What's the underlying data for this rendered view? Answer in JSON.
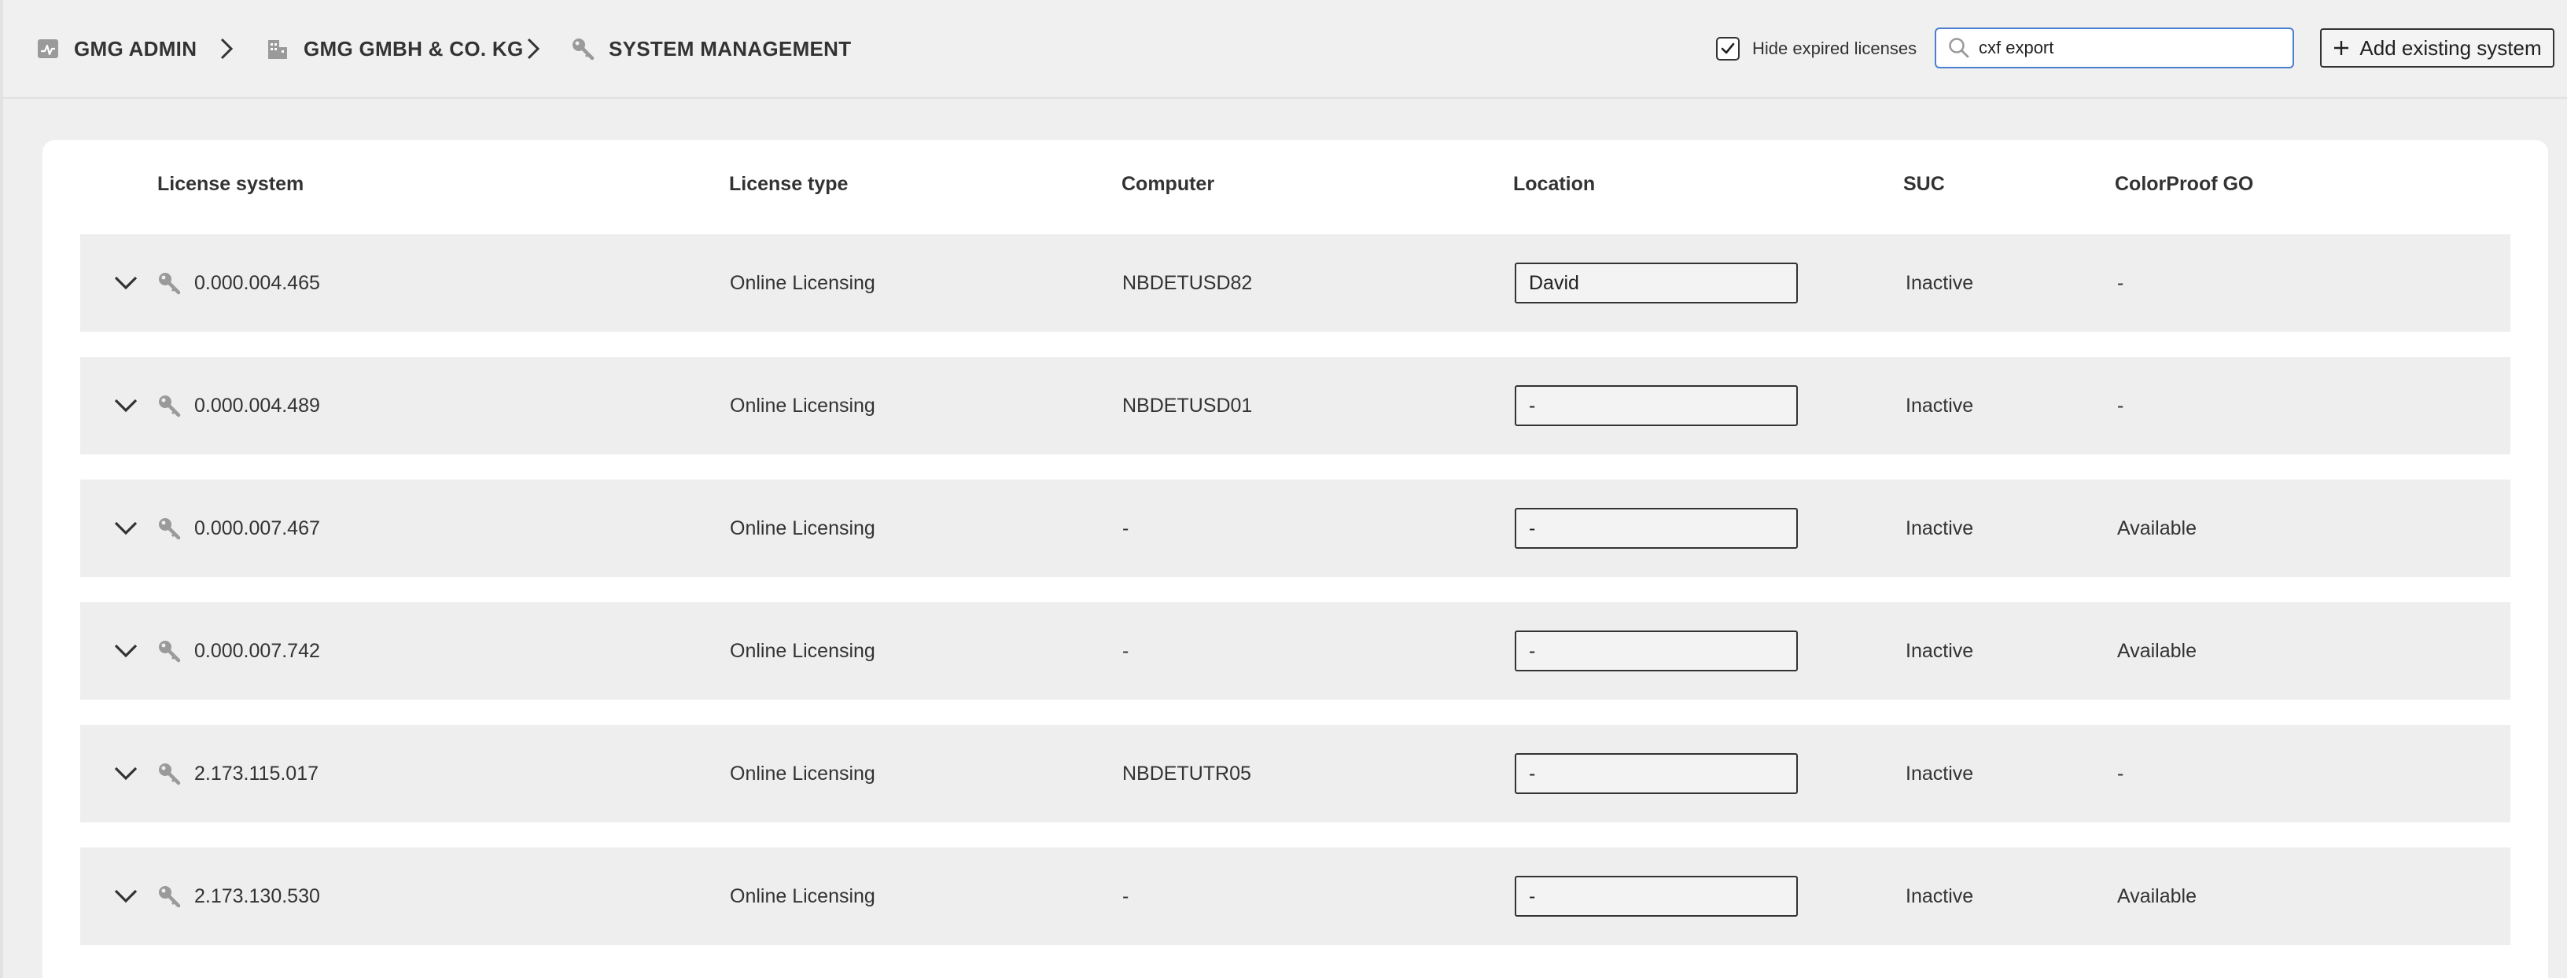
{
  "breadcrumb": {
    "items": [
      {
        "label": "GMG ADMIN",
        "icon": "admin-dashboard-icon"
      },
      {
        "label": "GMG GMBH & CO. KG",
        "icon": "building-icon"
      },
      {
        "label": "SYSTEM MANAGEMENT",
        "icon": "key-icon"
      }
    ],
    "separator_icon": "chevron-right-icon"
  },
  "toolbar": {
    "hide_expired_label": "Hide expired licenses",
    "hide_expired_checked": true,
    "search_value": "cxf export",
    "search_icon": "search-icon",
    "add_button_label": "Add existing system",
    "add_button_icon": "plus-icon"
  },
  "table": {
    "columns": {
      "license_system": "License system",
      "license_type": "License type",
      "computer": "Computer",
      "location": "Location",
      "suc": "SUC",
      "colorproof_go": "ColorProof GO"
    },
    "rows": [
      {
        "license_system": "0.000.004.465",
        "license_type": "Online Licensing",
        "computer": "NBDETUSD82",
        "location": "David",
        "suc": "Inactive",
        "colorproof_go": "-"
      },
      {
        "license_system": "0.000.004.489",
        "license_type": "Online Licensing",
        "computer": "NBDETUSD01",
        "location": "-",
        "suc": "Inactive",
        "colorproof_go": "-"
      },
      {
        "license_system": "0.000.007.467",
        "license_type": "Online Licensing",
        "computer": "-",
        "location": "-",
        "suc": "Inactive",
        "colorproof_go": "Available"
      },
      {
        "license_system": "0.000.007.742",
        "license_type": "Online Licensing",
        "computer": "-",
        "location": "-",
        "suc": "Inactive",
        "colorproof_go": "Available"
      },
      {
        "license_system": "2.173.115.017",
        "license_type": "Online Licensing",
        "computer": "NBDETUTR05",
        "location": "-",
        "suc": "Inactive",
        "colorproof_go": "-"
      },
      {
        "license_system": "2.173.130.530",
        "license_type": "Online Licensing",
        "computer": "-",
        "location": "-",
        "suc": "Inactive",
        "colorproof_go": "Available"
      }
    ],
    "row_expand_icon": "chevron-down-icon",
    "row_icon": "key-icon"
  },
  "colors": {
    "page_background": "#efefef",
    "card_background": "#ffffff",
    "row_background": "#eeeeee",
    "search_focus_border": "#4a7fcf",
    "text": "#333333",
    "icon_gray": "#9a9a9a"
  }
}
